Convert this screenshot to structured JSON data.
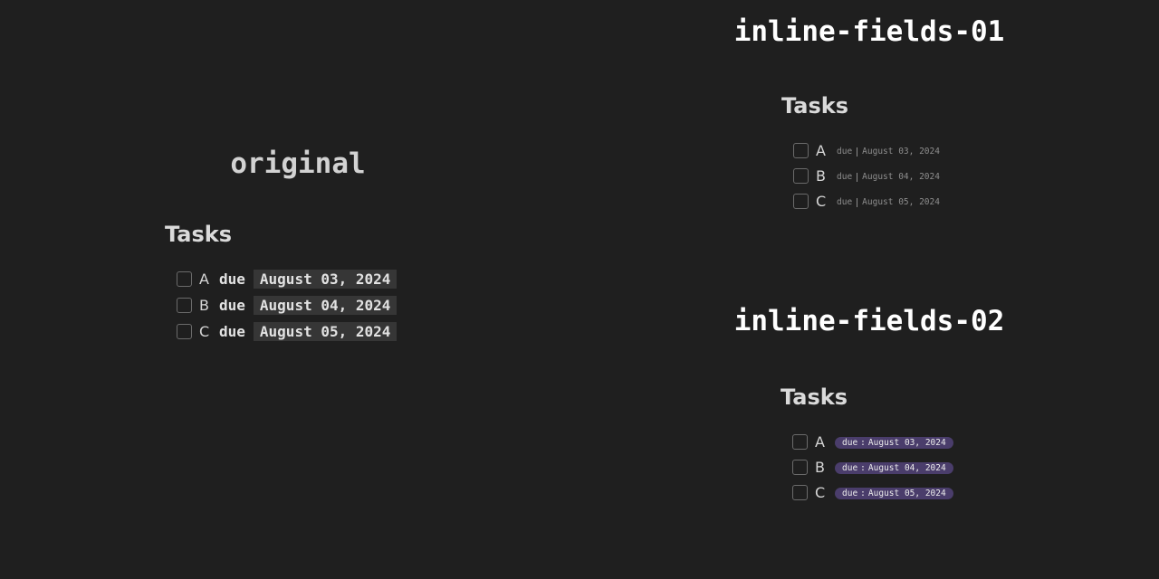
{
  "panels": {
    "original": {
      "title": "original",
      "heading": "Tasks",
      "tasks": [
        {
          "letter": "A",
          "key": "due",
          "value": "August 03, 2024"
        },
        {
          "letter": "B",
          "key": "due",
          "value": "August 04, 2024"
        },
        {
          "letter": "C",
          "key": "due",
          "value": "August 05, 2024"
        }
      ]
    },
    "inline_fields_01": {
      "title": "inline-fields-01",
      "heading": "Tasks",
      "tasks": [
        {
          "letter": "A",
          "key": "due",
          "value": "August 03, 2024"
        },
        {
          "letter": "B",
          "key": "due",
          "value": "August 04, 2024"
        },
        {
          "letter": "C",
          "key": "due",
          "value": "August 05, 2024"
        }
      ]
    },
    "inline_fields_02": {
      "title": "inline-fields-02",
      "heading": "Tasks",
      "tasks": [
        {
          "letter": "A",
          "key": "due",
          "separator": ":",
          "value": "August 03, 2024"
        },
        {
          "letter": "B",
          "key": "due",
          "separator": ":",
          "value": "August 04, 2024"
        },
        {
          "letter": "C",
          "key": "due",
          "separator": ":",
          "value": "August 05, 2024"
        }
      ]
    }
  },
  "colors": {
    "background": "#1f1f1f",
    "value_highlight": "#363636",
    "pill": "#4a3d6b",
    "checkbox_border": "#6b6b6b"
  }
}
